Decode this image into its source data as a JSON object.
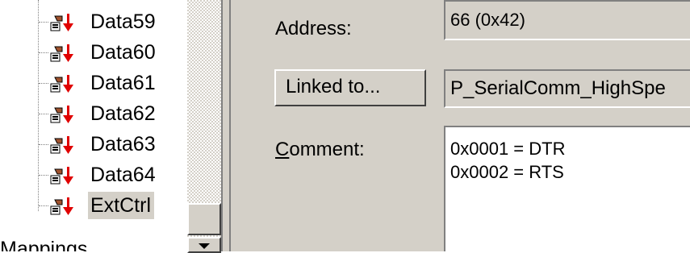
{
  "tree": {
    "items": [
      {
        "label": "Data59",
        "selected": false
      },
      {
        "label": "Data60",
        "selected": false
      },
      {
        "label": "Data61",
        "selected": false
      },
      {
        "label": "Data62",
        "selected": false
      },
      {
        "label": "Data63",
        "selected": false
      },
      {
        "label": "Data64",
        "selected": false
      },
      {
        "label": "ExtCtrl",
        "selected": true
      }
    ],
    "item_icon": "red-down-arrow-variable-icon",
    "parent_label": "Mappings"
  },
  "properties": {
    "address_label": "Address:",
    "address_value": "66 (0x42)",
    "linked_button_label": "Linked to...",
    "linked_value": "P_SerialComm_HighSpe",
    "comment_label_access_key": "C",
    "comment_label_rest": "omment:",
    "comment_lines": [
      "0x0001 = DTR",
      "0x0002 = RTS"
    ]
  },
  "colors": {
    "face": "#d4d0c8",
    "arrow_red": "#e00000",
    "icon_brown": "#a0522d"
  }
}
